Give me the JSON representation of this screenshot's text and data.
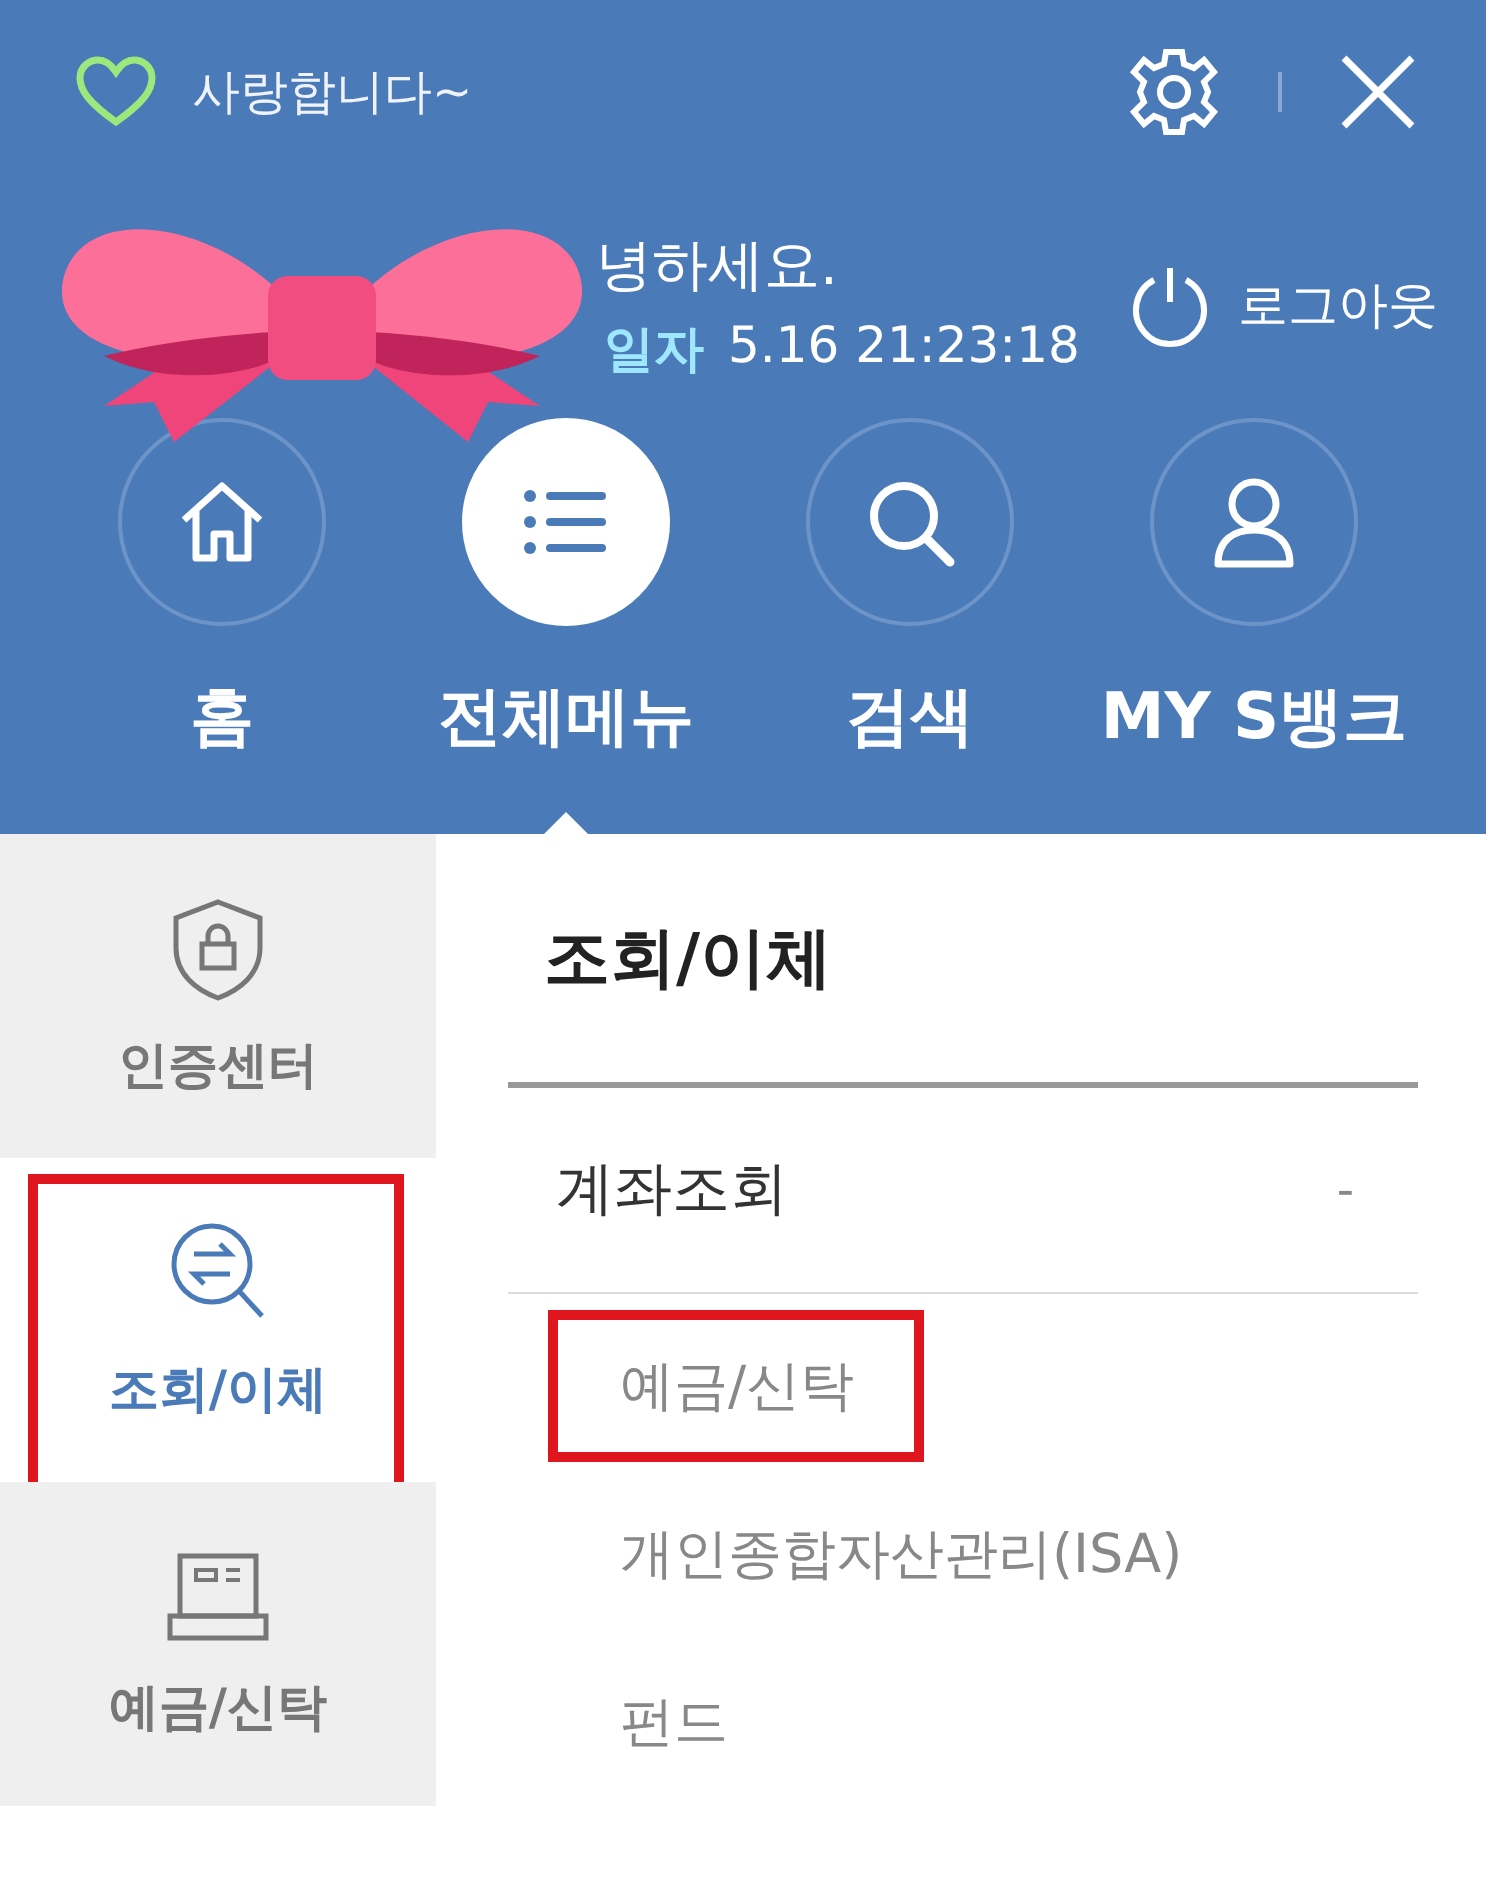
{
  "top_bar": {
    "message": "사랑합니다~"
  },
  "user": {
    "greeting": "녕하세요.",
    "login_label": "일자",
    "login_time": "5.16 21:23:18",
    "logout": "로그아웃"
  },
  "nav": [
    {
      "kind": "home",
      "label": "홈",
      "selected": false
    },
    {
      "kind": "menu",
      "label": "전체메뉴",
      "selected": true
    },
    {
      "kind": "search",
      "label": "검색",
      "selected": false
    },
    {
      "kind": "person",
      "label": "MY S뱅크",
      "selected": false
    }
  ],
  "sidebar": {
    "items": [
      {
        "kind": "shield",
        "label": "인증센터",
        "selected": false,
        "highlighted": false
      },
      {
        "kind": "transfer",
        "label": "조회/이체",
        "selected": true,
        "highlighted": true
      },
      {
        "kind": "deposit",
        "label": "예금/신탁",
        "selected": false,
        "highlighted": false
      }
    ]
  },
  "content": {
    "title": "조회/이체",
    "section": {
      "label": "계좌조회",
      "toggle": "-",
      "expanded": true,
      "items": [
        {
          "label": "예금/신탁",
          "highlighted": true
        },
        {
          "label": "개인종합자산관리(ISA)",
          "highlighted": false
        },
        {
          "label": "펀드",
          "highlighted": false
        }
      ]
    }
  }
}
